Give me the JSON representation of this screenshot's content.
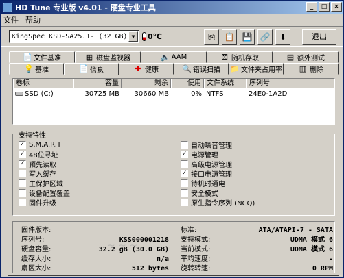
{
  "window": {
    "title": "HD Tune 专业版 v4.01 - 硬盘专业工具",
    "controls": [
      "_",
      "□",
      "×"
    ]
  },
  "menu": {
    "file": "文件",
    "help": "帮助"
  },
  "toolbar": {
    "drive": "KingSpec KSD-SA25.1-     (32 GB)",
    "temperature": "0℃",
    "exit_label": "退出"
  },
  "tabs_top": [
    {
      "label": "文件基准",
      "icon": "file-icon"
    },
    {
      "label": "磁盘监视器",
      "icon": "monitor-icon"
    },
    {
      "label": "AAM",
      "icon": "speaker-icon"
    },
    {
      "label": "随机存取",
      "icon": "random-icon"
    },
    {
      "label": "额外测试",
      "icon": "extra-test-icon"
    }
  ],
  "tabs_bottom": [
    {
      "label": "基准",
      "icon": "benchmark-icon"
    },
    {
      "label": "信息",
      "icon": "info-icon"
    },
    {
      "label": "健康",
      "icon": "health-icon"
    },
    {
      "label": "错误扫描",
      "icon": "scan-icon"
    },
    {
      "label": "文件夹占用率",
      "icon": "folder-icon"
    },
    {
      "label": "删除",
      "icon": "delete-icon"
    }
  ],
  "volumes": {
    "headers": [
      "卷标",
      "容量",
      "剩余",
      "使用",
      "文件系统",
      "序列号"
    ],
    "rows": [
      {
        "label": "SSD (C:)",
        "capacity": "30725 MB",
        "free": "30660 MB",
        "used": "0%",
        "fs": "NTFS",
        "serial": "24E0-1A2D"
      }
    ]
  },
  "features": {
    "title": "支持特性",
    "left": [
      {
        "label": "S.M.A.R.T",
        "checked": true
      },
      {
        "label": "48位寻址",
        "checked": true
      },
      {
        "label": "预先读取",
        "checked": true
      },
      {
        "label": "写入缓存",
        "checked": false
      },
      {
        "label": "主保护区域",
        "checked": false
      },
      {
        "label": "设备配置覆盖",
        "checked": false
      },
      {
        "label": "固件升级",
        "checked": false
      }
    ],
    "right": [
      {
        "label": "自动噪音管理",
        "checked": false
      },
      {
        "label": "电源管理",
        "checked": true
      },
      {
        "label": "高级电源管理",
        "checked": false
      },
      {
        "label": "接口电源管理",
        "checked": true
      },
      {
        "label": "待机时通电",
        "checked": false
      },
      {
        "label": "安全模式",
        "checked": false
      },
      {
        "label": "原生指令序列 (NCQ)",
        "checked": false
      }
    ]
  },
  "info": {
    "left": [
      {
        "label": "固件版本:",
        "value": ""
      },
      {
        "label": "序列号:",
        "value": "KSS000001218"
      },
      {
        "label": "硬盘容量:",
        "value": "32.2 gB (30.0 GB)"
      },
      {
        "label": "缓存大小:",
        "value": "n/a"
      },
      {
        "label": "扇区大小:",
        "value": "512 bytes"
      }
    ],
    "right": [
      {
        "label": "标准:",
        "value": "ATA/ATAPI-7 - SATA"
      },
      {
        "label": "支持模式:",
        "value": "UDMA 模式 6"
      },
      {
        "label": "当前模式:",
        "value": "UDMA 模式 6"
      },
      {
        "label": "平均速度:",
        "value": "-"
      },
      {
        "label": "旋转转速:",
        "value": "0 RPM"
      }
    ]
  }
}
